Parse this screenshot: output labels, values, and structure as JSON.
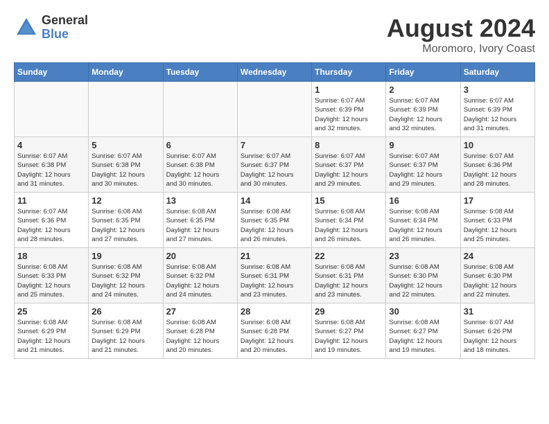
{
  "header": {
    "logo_general": "General",
    "logo_blue": "Blue",
    "title": "August 2024",
    "location": "Moromoro, Ivory Coast"
  },
  "days_of_week": [
    "Sunday",
    "Monday",
    "Tuesday",
    "Wednesday",
    "Thursday",
    "Friday",
    "Saturday"
  ],
  "weeks": [
    [
      {
        "day": "",
        "info": "",
        "empty": true
      },
      {
        "day": "",
        "info": "",
        "empty": true
      },
      {
        "day": "",
        "info": "",
        "empty": true
      },
      {
        "day": "",
        "info": "",
        "empty": true
      },
      {
        "day": "1",
        "info": "Sunrise: 6:07 AM\nSunset: 6:39 PM\nDaylight: 12 hours\nand 32 minutes."
      },
      {
        "day": "2",
        "info": "Sunrise: 6:07 AM\nSunset: 6:39 PM\nDaylight: 12 hours\nand 32 minutes."
      },
      {
        "day": "3",
        "info": "Sunrise: 6:07 AM\nSunset: 6:39 PM\nDaylight: 12 hours\nand 31 minutes."
      }
    ],
    [
      {
        "day": "4",
        "info": "Sunrise: 6:07 AM\nSunset: 6:38 PM\nDaylight: 12 hours\nand 31 minutes.",
        "shaded": true
      },
      {
        "day": "5",
        "info": "Sunrise: 6:07 AM\nSunset: 6:38 PM\nDaylight: 12 hours\nand 30 minutes.",
        "shaded": true
      },
      {
        "day": "6",
        "info": "Sunrise: 6:07 AM\nSunset: 6:38 PM\nDaylight: 12 hours\nand 30 minutes.",
        "shaded": true
      },
      {
        "day": "7",
        "info": "Sunrise: 6:07 AM\nSunset: 6:37 PM\nDaylight: 12 hours\nand 30 minutes.",
        "shaded": true
      },
      {
        "day": "8",
        "info": "Sunrise: 6:07 AM\nSunset: 6:37 PM\nDaylight: 12 hours\nand 29 minutes.",
        "shaded": true
      },
      {
        "day": "9",
        "info": "Sunrise: 6:07 AM\nSunset: 6:37 PM\nDaylight: 12 hours\nand 29 minutes.",
        "shaded": true
      },
      {
        "day": "10",
        "info": "Sunrise: 6:07 AM\nSunset: 6:36 PM\nDaylight: 12 hours\nand 28 minutes.",
        "shaded": true
      }
    ],
    [
      {
        "day": "11",
        "info": "Sunrise: 6:07 AM\nSunset: 6:36 PM\nDaylight: 12 hours\nand 28 minutes."
      },
      {
        "day": "12",
        "info": "Sunrise: 6:08 AM\nSunset: 6:35 PM\nDaylight: 12 hours\nand 27 minutes."
      },
      {
        "day": "13",
        "info": "Sunrise: 6:08 AM\nSunset: 6:35 PM\nDaylight: 12 hours\nand 27 minutes."
      },
      {
        "day": "14",
        "info": "Sunrise: 6:08 AM\nSunset: 6:35 PM\nDaylight: 12 hours\nand 26 minutes."
      },
      {
        "day": "15",
        "info": "Sunrise: 6:08 AM\nSunset: 6:34 PM\nDaylight: 12 hours\nand 26 minutes."
      },
      {
        "day": "16",
        "info": "Sunrise: 6:08 AM\nSunset: 6:34 PM\nDaylight: 12 hours\nand 26 minutes."
      },
      {
        "day": "17",
        "info": "Sunrise: 6:08 AM\nSunset: 6:33 PM\nDaylight: 12 hours\nand 25 minutes."
      }
    ],
    [
      {
        "day": "18",
        "info": "Sunrise: 6:08 AM\nSunset: 6:33 PM\nDaylight: 12 hours\nand 25 minutes.",
        "shaded": true
      },
      {
        "day": "19",
        "info": "Sunrise: 6:08 AM\nSunset: 6:32 PM\nDaylight: 12 hours\nand 24 minutes.",
        "shaded": true
      },
      {
        "day": "20",
        "info": "Sunrise: 6:08 AM\nSunset: 6:32 PM\nDaylight: 12 hours\nand 24 minutes.",
        "shaded": true
      },
      {
        "day": "21",
        "info": "Sunrise: 6:08 AM\nSunset: 6:31 PM\nDaylight: 12 hours\nand 23 minutes.",
        "shaded": true
      },
      {
        "day": "22",
        "info": "Sunrise: 6:08 AM\nSunset: 6:31 PM\nDaylight: 12 hours\nand 23 minutes.",
        "shaded": true
      },
      {
        "day": "23",
        "info": "Sunrise: 6:08 AM\nSunset: 6:30 PM\nDaylight: 12 hours\nand 22 minutes.",
        "shaded": true
      },
      {
        "day": "24",
        "info": "Sunrise: 6:08 AM\nSunset: 6:30 PM\nDaylight: 12 hours\nand 22 minutes.",
        "shaded": true
      }
    ],
    [
      {
        "day": "25",
        "info": "Sunrise: 6:08 AM\nSunset: 6:29 PM\nDaylight: 12 hours\nand 21 minutes."
      },
      {
        "day": "26",
        "info": "Sunrise: 6:08 AM\nSunset: 6:29 PM\nDaylight: 12 hours\nand 21 minutes."
      },
      {
        "day": "27",
        "info": "Sunrise: 6:08 AM\nSunset: 6:28 PM\nDaylight: 12 hours\nand 20 minutes."
      },
      {
        "day": "28",
        "info": "Sunrise: 6:08 AM\nSunset: 6:28 PM\nDaylight: 12 hours\nand 20 minutes."
      },
      {
        "day": "29",
        "info": "Sunrise: 6:08 AM\nSunset: 6:27 PM\nDaylight: 12 hours\nand 19 minutes."
      },
      {
        "day": "30",
        "info": "Sunrise: 6:08 AM\nSunset: 6:27 PM\nDaylight: 12 hours\nand 19 minutes."
      },
      {
        "day": "31",
        "info": "Sunrise: 6:07 AM\nSunset: 6:26 PM\nDaylight: 12 hours\nand 18 minutes."
      }
    ]
  ]
}
